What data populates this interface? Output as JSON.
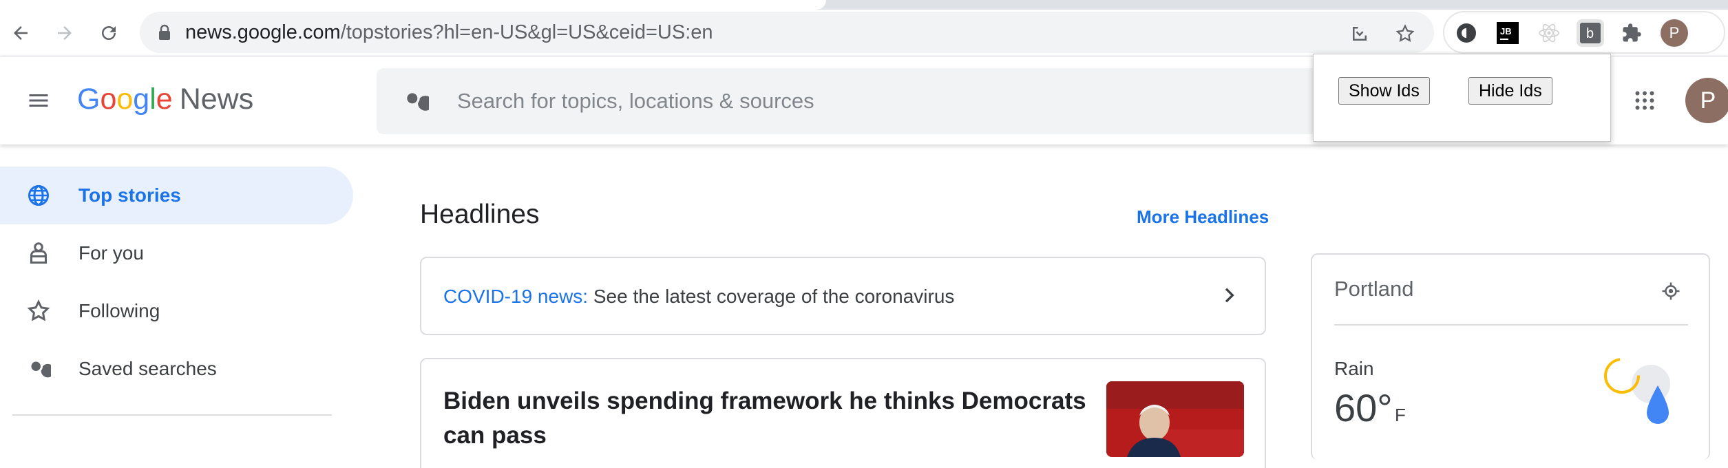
{
  "browser": {
    "url_host": "news.google.com",
    "url_path": "/topstories?hl=en-US&gl=US&ceid=US:en",
    "profile_initial": "P"
  },
  "extension_popup": {
    "show_label": "Show Ids",
    "hide_label": "Hide Ids"
  },
  "header": {
    "logo_letters": [
      "G",
      "o",
      "o",
      "g",
      "l",
      "e"
    ],
    "logo_product": "News",
    "search_placeholder": "Search for topics, locations & sources",
    "profile_initial": "P"
  },
  "sidebar": {
    "items": [
      {
        "label": "Top stories",
        "icon": "globe-icon",
        "active": true
      },
      {
        "label": "For you",
        "icon": "person-icon",
        "active": false
      },
      {
        "label": "Following",
        "icon": "star-icon",
        "active": false
      },
      {
        "label": "Saved searches",
        "icon": "search-icon",
        "active": false
      }
    ]
  },
  "main": {
    "section_title": "Headlines",
    "more_link": "More Headlines",
    "covid": {
      "link_text": "COVID-19 news:",
      "text": " See the latest coverage of the coronavirus"
    },
    "top_story": {
      "title": "Biden unveils spending framework he thinks Democrats can pass"
    }
  },
  "weather": {
    "city": "Portland",
    "condition": "Rain",
    "temperature": "60°",
    "unit": "F"
  },
  "colors": {
    "accent": "#1a73e8",
    "active_bg": "#e8f0fe"
  }
}
